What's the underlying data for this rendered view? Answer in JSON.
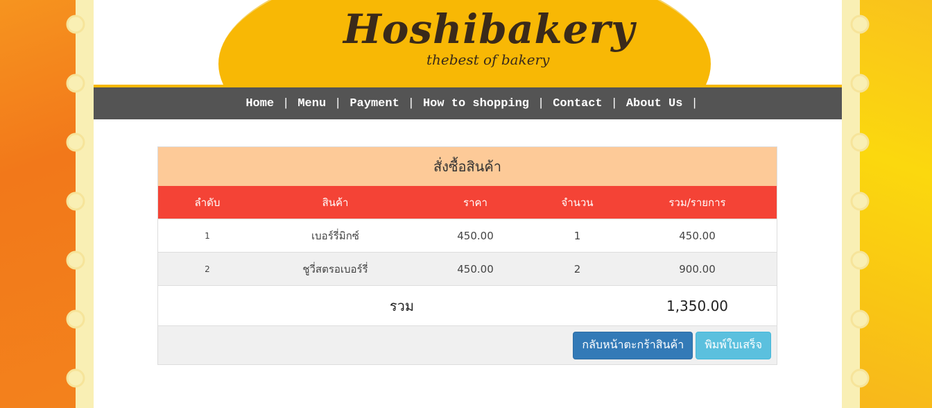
{
  "brand": {
    "name": "Hoshibakery",
    "tagline": "thebest of bakery",
    "accent": "#f8b805"
  },
  "nav": {
    "items": [
      "Home",
      "Menu",
      "Payment",
      "How to shopping",
      "Contact",
      "About Us"
    ],
    "separator": "|"
  },
  "order": {
    "title": "สั่งซื้อสินค้า",
    "columns": [
      "ลำดับ",
      "สินค้า",
      "ราคา",
      "จำนวน",
      "รวม/รายการ"
    ],
    "rows": [
      {
        "no": "1",
        "product": "เบอร์รี่มิกซ์",
        "price": "450.00",
        "qty": "1",
        "subtotal": "450.00"
      },
      {
        "no": "2",
        "product": "ชูวี่สตรอเบอร์รี่",
        "price": "450.00",
        "qty": "2",
        "subtotal": "900.00"
      }
    ],
    "total_label": "รวม",
    "total_value": "1,350.00",
    "header_color": "#f44336",
    "title_bg": "#fdca98"
  },
  "actions": {
    "back_label": "กลับหน้าตะกร้าสินค้า",
    "print_label": "พิมพ์ใบเสร็จ"
  }
}
